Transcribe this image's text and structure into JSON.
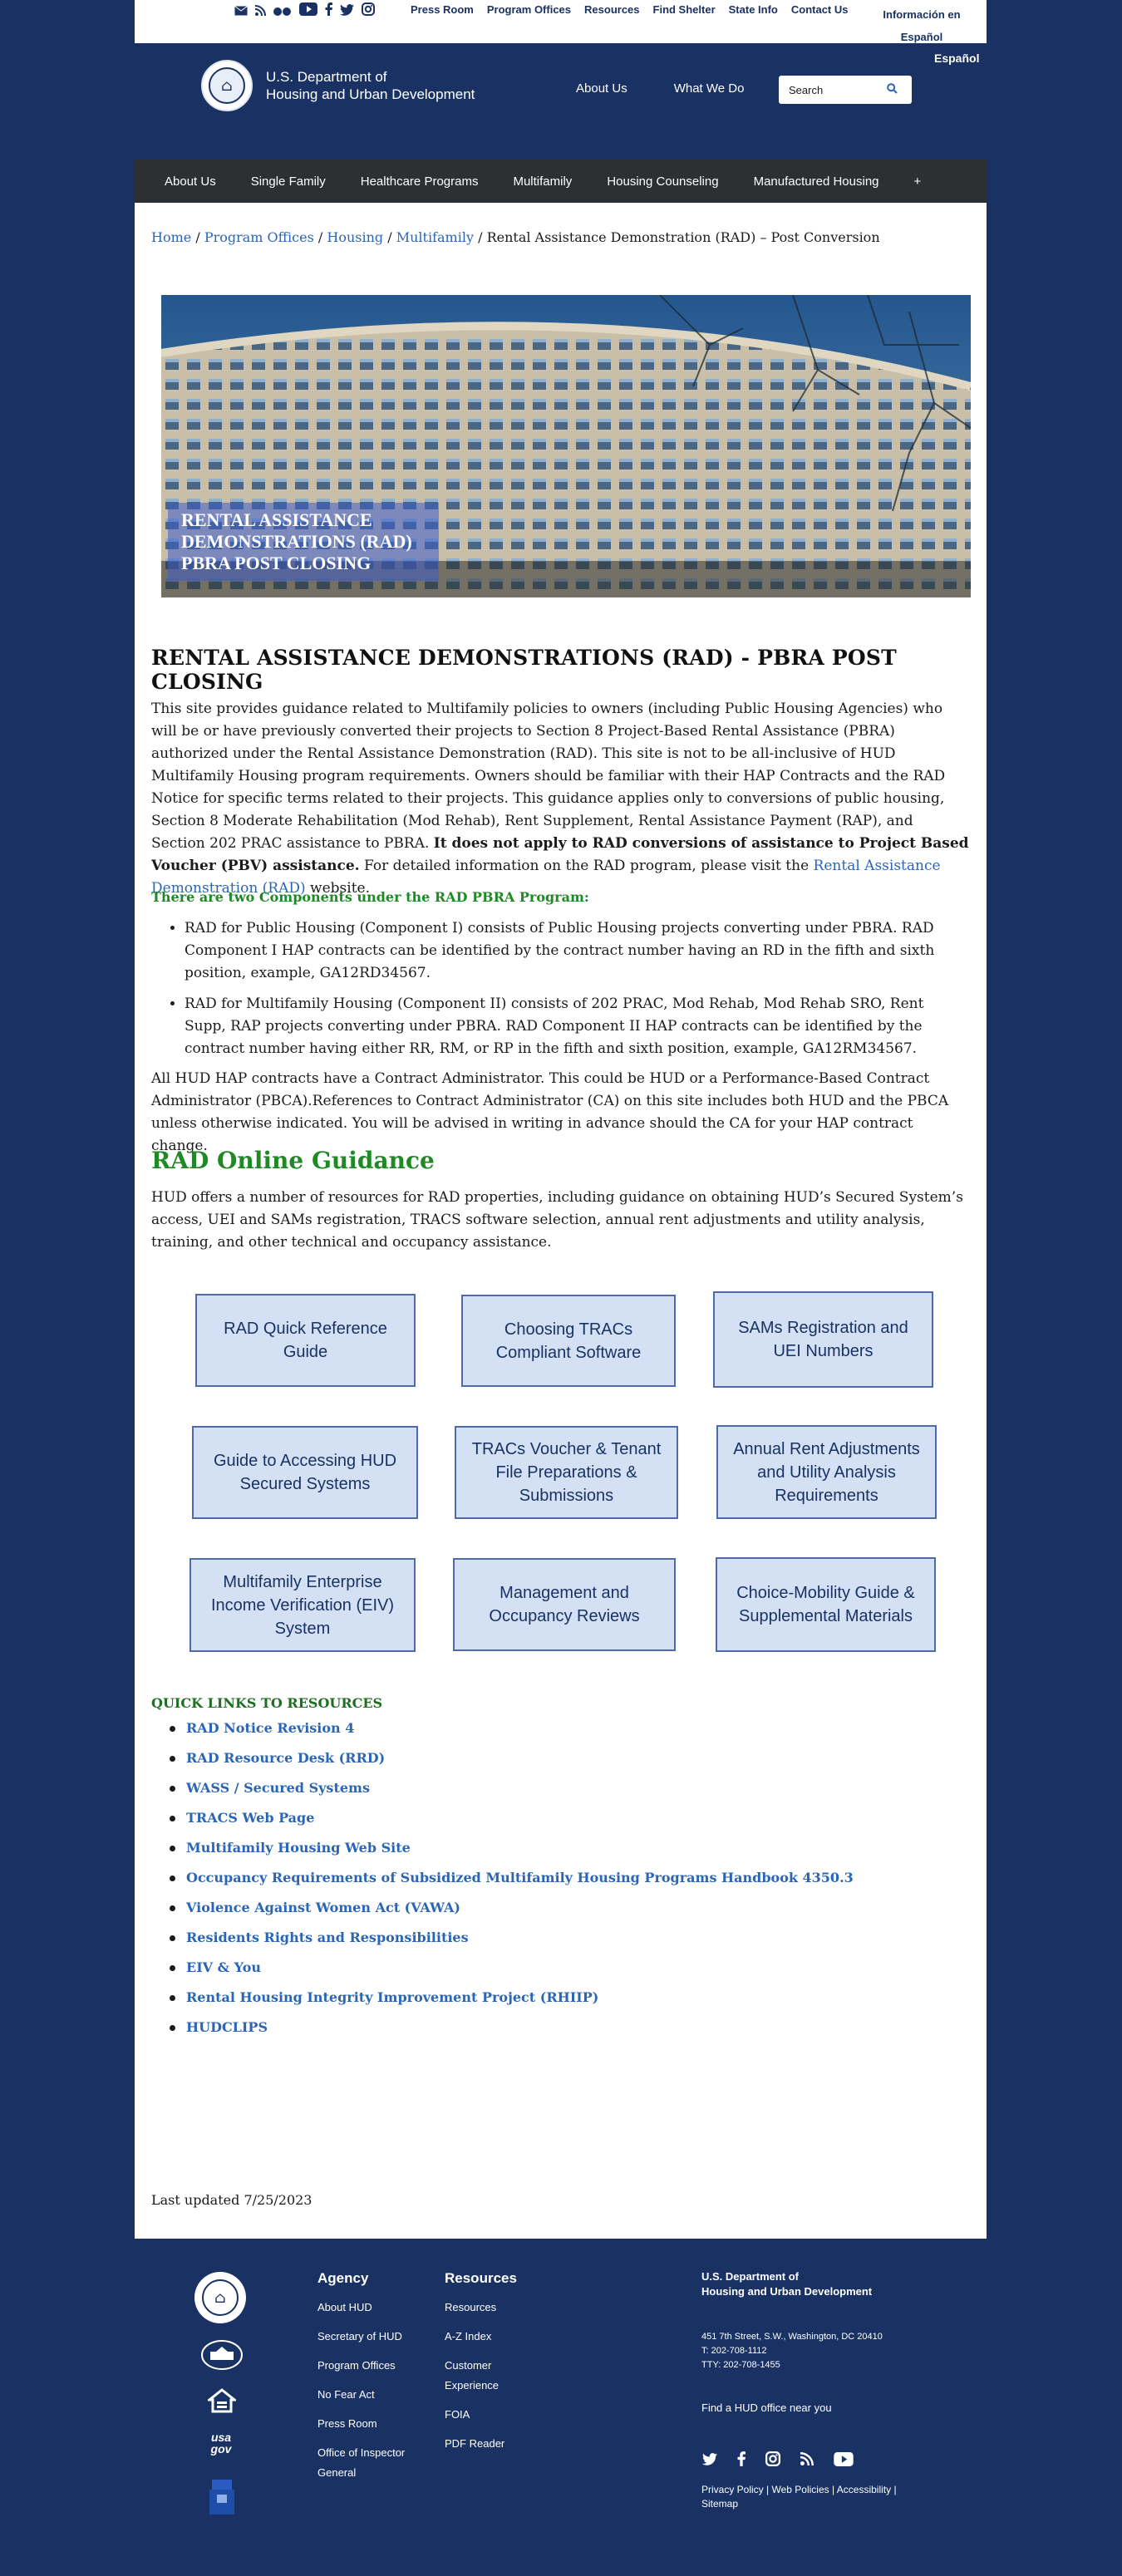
{
  "utility": {
    "links": [
      "Press Room",
      "Program Offices",
      "Resources",
      "Find Shelter",
      "State Info",
      "Contact Us"
    ],
    "spanish_link": "Información en Español",
    "espanol": "Español",
    "social_icons": [
      "email-icon",
      "rss-icon",
      "flickr-icon",
      "youtube-icon",
      "facebook-icon",
      "twitter-icon",
      "instagram-icon"
    ]
  },
  "header": {
    "agency_line1": "U.S. Department of",
    "agency_line2": "Housing and Urban Development",
    "nav": [
      "About Us",
      "What We Do"
    ],
    "search_placeholder": "Search"
  },
  "mainnav": [
    "About Us",
    "Single Family",
    "Healthcare Programs",
    "Multifamily",
    "Housing Counseling",
    "Manufactured Housing",
    "+"
  ],
  "breadcrumb": {
    "items": [
      "Home",
      "Program Offices",
      "Housing",
      "Multifamily"
    ],
    "sep": "/",
    "current": "Rental Assistance Demonstration (RAD) – Post Conversion"
  },
  "hero": {
    "caption": [
      "RENTAL ASSISTANCE",
      "DEMONSTRATIONS (RAD)",
      "PBRA POST CLOSING"
    ]
  },
  "page_title": "RENTAL ASSISTANCE DEMONSTRATIONS (RAD) - PBRA POST CLOSING",
  "intro": {
    "text1": "This site provides guidance related to Multifamily policies to owners (including Public Housing Agencies) who will be or have previously converted their projects to Section 8 Project-Based Rental Assistance (PBRA) authorized under the Rental Assistance Demonstration (RAD). This site is not to be all-inclusive of HUD Multifamily Housing program requirements. Owners should be familiar with their HAP Contracts and the RAD Notice for specific terms related to their projects. This guidance applies only to conversions of public housing, Section 8 Moderate Rehabilitation (Mod Rehab), Rent Supplement, Rental Assistance Payment (RAP), and Section 202 PRAC assistance to PBRA.",
    "bold": "It does not apply to RAD conversions of assistance to Project Based Voucher (PBV) assistance.",
    "text2": "For detailed information on the RAD program, please visit the",
    "link": "Rental Assistance Demonstration (RAD)",
    "text3": "website."
  },
  "components": {
    "heading": "There are two Components under the RAD PBRA Program:",
    "items": [
      "RAD for Public Housing (Component I) consists of Public Housing projects converting under PBRA. RAD Component I HAP contracts can be identified by the contract number having an RD in the fifth and sixth position, example, GA12RD34567.",
      "RAD for Multifamily Housing (Component II) consists of 202 PRAC, Mod Rehab, Mod Rehab SRO, Rent Supp, RAP projects converting under PBRA. RAD Component II HAP contracts can be identified by the contract number having either RR, RM, or RP in the fifth and sixth position, example, GA12RM34567."
    ]
  },
  "contract_admin": "All HUD HAP contracts have a Contract Administrator. This could be HUD or a Performance-Based Contract Administrator (PBCA).References to Contract Administrator (CA) on this site includes both HUD and the PBCA unless otherwise indicated. You will be advised in writing in advance should the CA for your HAP contract change.",
  "guidance": {
    "heading": "RAD Online Guidance",
    "text": "HUD offers a number of resources for RAD properties, including guidance on obtaining HUD’s Secured System’s access, UEI and SAMs registration, TRACS software selection, annual rent adjustments and utility analysis, training, and other technical and occupancy assistance."
  },
  "tiles": [
    "RAD Quick Reference Guide",
    "Choosing TRACs Compliant Software",
    "SAMs Registration and UEI Numbers",
    "Guide to Accessing HUD Secured Systems",
    "TRACs Voucher & Tenant File Preparations & Submissions",
    "Annual Rent Adjustments and Utility Analysis Requirements",
    "Multifamily Enterprise Income Verification (EIV) System",
    "Management and Occupancy Reviews",
    "Choice-Mobility Guide & Supplemental Materials"
  ],
  "quick_links": {
    "heading": "QUICK LINKS TO RESOURCES",
    "items": [
      "RAD Notice Revision 4",
      "RAD Resource Desk (RRD)",
      "WASS / Secured Systems",
      "TRACS Web Page",
      "Multifamily Housing Web Site",
      "Occupancy Requirements of Subsidized Multifamily Housing Programs Handbook 4350.3",
      "Violence Against Women Act (VAWA)",
      "Residents Rights and Responsibilities",
      "EIV & You",
      "Rental Housing Integrity Improvement Project (RHIIP)",
      "HUDCLIPS"
    ]
  },
  "last_updated": "Last updated 7/25/2023",
  "footer": {
    "agency_heading": "Agency",
    "agency_links": [
      "About HUD",
      "Secretary of HUD",
      "Program Offices",
      "No Fear Act",
      "Press Room",
      "Office of Inspector General"
    ],
    "resources_heading": "Resources",
    "resources_links": [
      "Resources",
      "A-Z Index",
      "Customer Experience",
      "FOIA",
      "PDF Reader"
    ],
    "org_line1": "U.S. Department of",
    "org_line2": "Housing and Urban Development",
    "address": "451 7th Street, S.W., Washington, DC 20410",
    "phone": "T: 202-708-1112",
    "tty": "TTY: 202-708-1455",
    "find_office": "Find a HUD office near you",
    "policy_links": [
      "Privacy Policy",
      "Web Policies",
      "Accessibility",
      "Sitemap"
    ],
    "usagov_label": "usa gov",
    "social_icons": [
      "twitter-icon",
      "facebook-icon",
      "instagram-icon",
      "rss-icon",
      "youtube-icon"
    ]
  },
  "colors": {
    "navy": "#1a3263",
    "nav_dark": "#2d3032",
    "link_blue": "#2a66b5",
    "green": "#1f8a24",
    "tile_fill": "#d4e1f5"
  }
}
